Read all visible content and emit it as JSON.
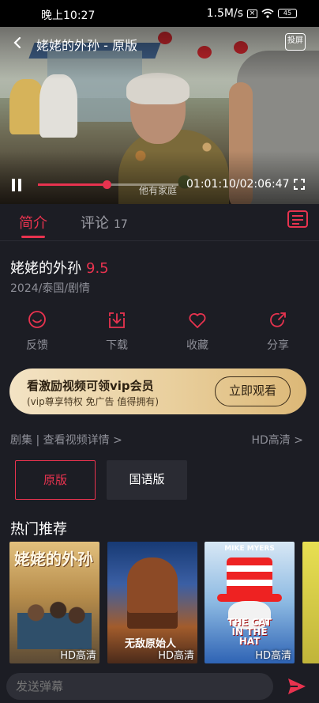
{
  "status_bar": {
    "time": "晚上10:27",
    "speed": "1.5M/s",
    "battery": "45"
  },
  "player": {
    "title": "姥姥的外孙 - 原版",
    "cast_label": "投屏",
    "subtitle": "他有家庭",
    "timecode": "01:01:10/02:06:47",
    "progress": 0.486
  },
  "tabs": {
    "intro": "简介",
    "comments": "评论",
    "comments_count": "17"
  },
  "movie": {
    "title": "姥姥的外孙",
    "rating": "9.5",
    "meta": "2024/泰国/剧情"
  },
  "actions": [
    {
      "label": "反馈"
    },
    {
      "label": "下载"
    },
    {
      "label": "收藏"
    },
    {
      "label": "分享"
    }
  ],
  "vip": {
    "title": "看激励视频可领vip会员",
    "subtitle": "(vip尊享特权 免广告 值得拥有)",
    "button": "立即观看"
  },
  "links": {
    "episodes": "剧集 | 查看视频详情 >",
    "quality": "HD高清 >"
  },
  "versions": {
    "original": "原版",
    "mandarin": "国语版"
  },
  "hot": {
    "title": "热门推荐",
    "posters": [
      {
        "badge": "HD高清",
        "art_text": "姥姥的外孙"
      },
      {
        "badge": "HD高清",
        "art_text": "无敌原始人"
      },
      {
        "badge": "HD高清",
        "art_text": "THE CAT IN THE HAT",
        "art_names": "MIKE MYERS"
      },
      {
        "badge": "",
        "art_text": ""
      }
    ]
  },
  "bottom": {
    "placeholder": "发送弹幕"
  },
  "colors": {
    "accent": "#e8334f",
    "background": "#1c1d24",
    "vip_gold": "#e9cf9d"
  }
}
